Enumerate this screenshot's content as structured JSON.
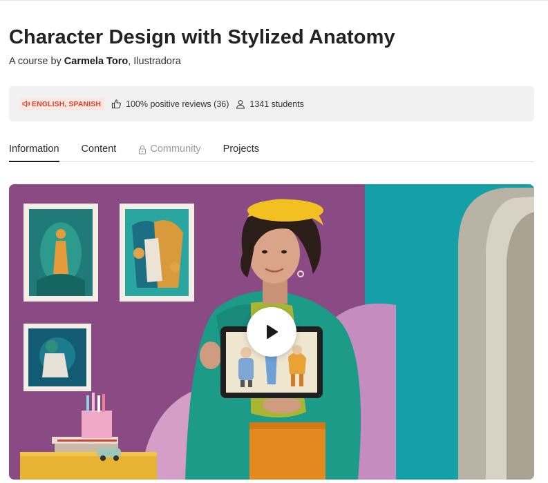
{
  "course": {
    "title": "Character Design with Stylized Anatomy",
    "byline_prefix": "A course by ",
    "author": "Carmela Toro",
    "author_role": ", Ilustradora"
  },
  "info_bar": {
    "languages": "ENGLISH, SPANISH",
    "reviews": "100% positive reviews (36)",
    "students": "1341 students",
    "icons": [
      "speaker-icon",
      "thumbs-up-icon",
      "user-icon"
    ],
    "badge_color": "#d2442d"
  },
  "tabs": [
    {
      "label": "Information",
      "active": true,
      "locked": false
    },
    {
      "label": "Content",
      "active": false,
      "locked": false
    },
    {
      "label": "Community",
      "active": false,
      "locked": true
    },
    {
      "label": "Projects",
      "active": false,
      "locked": false
    }
  ],
  "video": {
    "play_icon": "play-icon",
    "colors": {
      "wall": "#8d4e86",
      "teal_panel": "#1aa2a8",
      "jacket": "#1a9b8a",
      "hat": "#f2c021"
    }
  }
}
